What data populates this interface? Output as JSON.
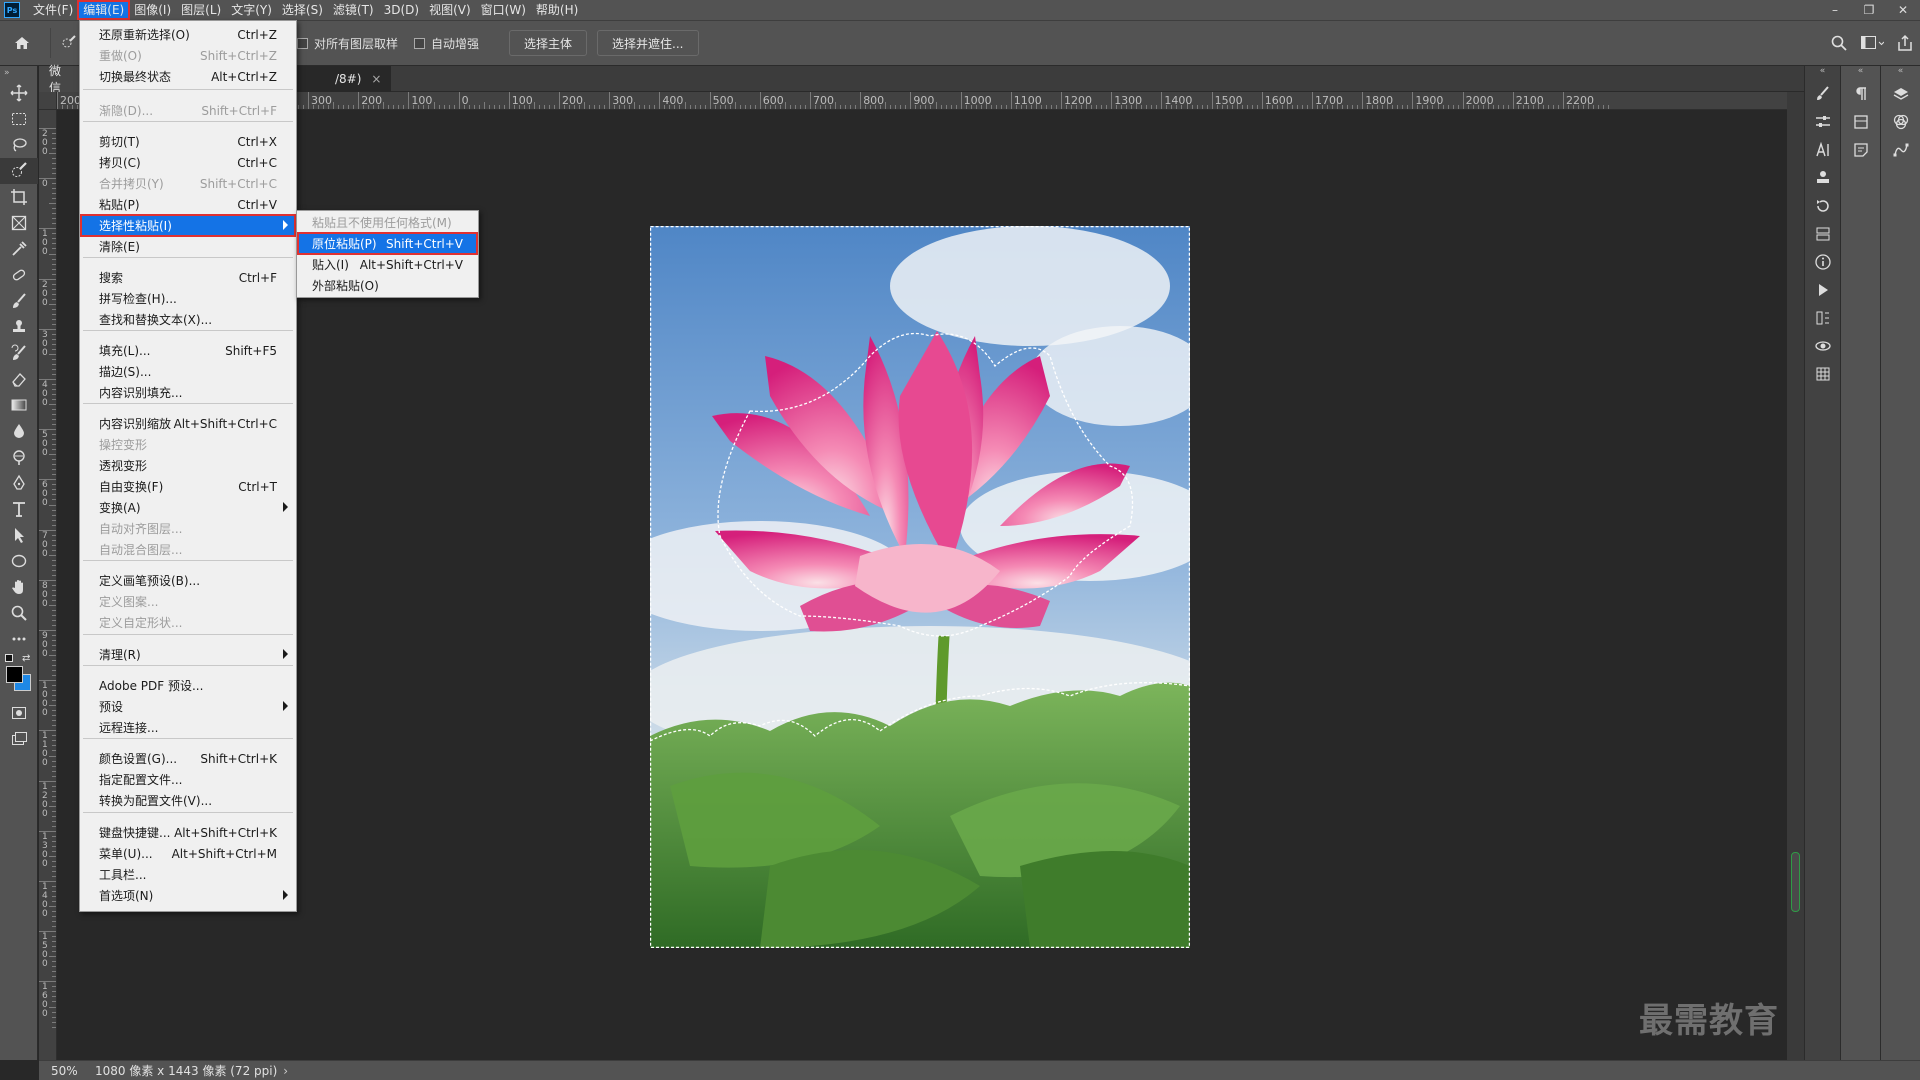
{
  "app": {
    "logo": "Ps"
  },
  "menubar": {
    "items": [
      "文件(F)",
      "编辑(E)",
      "图像(I)",
      "图层(L)",
      "文字(Y)",
      "选择(S)",
      "滤镜(T)",
      "3D(D)",
      "视图(V)",
      "窗口(W)",
      "帮助(H)"
    ],
    "active_index": 1
  },
  "window_controls": {
    "minimize": "–",
    "restore": "❐",
    "close": "✕"
  },
  "options": {
    "sample_all_layers": "对所有图层取样",
    "auto_enhance": "自动增强",
    "select_subject": "选择主体",
    "select_and_mask": "选择并遮住..."
  },
  "document": {
    "tab_partial_left": "微信",
    "tab_label": "/8#)",
    "tab_close": "×",
    "zoom": "50%",
    "dimensions": "1080 像素 x 1443 像素 (72 ppi)"
  },
  "ruler_h": [
    "200",
    "700",
    "600",
    "500",
    "400",
    "300",
    "200",
    "100",
    "0",
    "100",
    "200",
    "300",
    "400",
    "500",
    "600",
    "700",
    "800",
    "900",
    "1000",
    "1100",
    "1200",
    "1300",
    "1400",
    "1500",
    "1600",
    "1700",
    "1800",
    "1900",
    "2000",
    "2100",
    "2200"
  ],
  "ruler_v": [
    "200",
    "0",
    "100",
    "200",
    "300",
    "400",
    "500",
    "600",
    "700",
    "800",
    "900",
    "1000",
    "1100",
    "1200",
    "1300",
    "1400",
    "1500",
    "1600"
  ],
  "edit_menu": {
    "items": [
      {
        "label": "还原重新选择(O)",
        "shortcut": "Ctrl+Z",
        "disabled": false
      },
      {
        "label": "重做(O)",
        "shortcut": "Shift+Ctrl+Z",
        "disabled": true
      },
      {
        "label": "切换最终状态",
        "shortcut": "Alt+Ctrl+Z",
        "disabled": false
      },
      {
        "label": "渐隐(D)...",
        "shortcut": "Shift+Ctrl+F",
        "disabled": true
      },
      {
        "label": "剪切(T)",
        "shortcut": "Ctrl+X",
        "disabled": false
      },
      {
        "label": "拷贝(C)",
        "shortcut": "Ctrl+C",
        "disabled": false
      },
      {
        "label": "合并拷贝(Y)",
        "shortcut": "Shift+Ctrl+C",
        "disabled": true
      },
      {
        "label": "粘贴(P)",
        "shortcut": "Ctrl+V",
        "disabled": false
      },
      {
        "label": "选择性粘贴(I)",
        "shortcut": "",
        "disabled": false
      },
      {
        "label": "清除(E)",
        "shortcut": "",
        "disabled": false
      },
      {
        "label": "搜索",
        "shortcut": "Ctrl+F",
        "disabled": false
      },
      {
        "label": "拼写检查(H)...",
        "shortcut": "",
        "disabled": false
      },
      {
        "label": "查找和替换文本(X)...",
        "shortcut": "",
        "disabled": false
      },
      {
        "label": "填充(L)...",
        "shortcut": "Shift+F5",
        "disabled": false
      },
      {
        "label": "描边(S)...",
        "shortcut": "",
        "disabled": false
      },
      {
        "label": "内容识别填充...",
        "shortcut": "",
        "disabled": false
      },
      {
        "label": "内容识别缩放",
        "shortcut": "Alt+Shift+Ctrl+C",
        "disabled": false
      },
      {
        "label": "操控变形",
        "shortcut": "",
        "disabled": true
      },
      {
        "label": "透视变形",
        "shortcut": "",
        "disabled": false
      },
      {
        "label": "自由变换(F)",
        "shortcut": "Ctrl+T",
        "disabled": false
      },
      {
        "label": "变换(A)",
        "shortcut": "",
        "disabled": false
      },
      {
        "label": "自动对齐图层...",
        "shortcut": "",
        "disabled": true
      },
      {
        "label": "自动混合图层...",
        "shortcut": "",
        "disabled": true
      },
      {
        "label": "定义画笔预设(B)...",
        "shortcut": "",
        "disabled": false
      },
      {
        "label": "定义图案...",
        "shortcut": "",
        "disabled": true
      },
      {
        "label": "定义自定形状...",
        "shortcut": "",
        "disabled": true
      },
      {
        "label": "清理(R)",
        "shortcut": "",
        "disabled": false
      },
      {
        "label": "Adobe PDF 预设...",
        "shortcut": "",
        "disabled": false
      },
      {
        "label": "预设",
        "shortcut": "",
        "disabled": false
      },
      {
        "label": "远程连接...",
        "shortcut": "",
        "disabled": false
      },
      {
        "label": "颜色设置(G)...",
        "shortcut": "Shift+Ctrl+K",
        "disabled": false
      },
      {
        "label": "指定配置文件...",
        "shortcut": "",
        "disabled": false
      },
      {
        "label": "转换为配置文件(V)...",
        "shortcut": "",
        "disabled": false
      },
      {
        "label": "键盘快捷键...",
        "shortcut": "Alt+Shift+Ctrl+K",
        "disabled": false
      },
      {
        "label": "菜单(U)...",
        "shortcut": "Alt+Shift+Ctrl+M",
        "disabled": false
      },
      {
        "label": "工具栏...",
        "shortcut": "",
        "disabled": false
      },
      {
        "label": "首选项(N)",
        "shortcut": "",
        "disabled": false
      }
    ],
    "highlighted_index": 8,
    "submenu_indices": [
      8,
      20,
      26,
      28,
      36
    ]
  },
  "paste_submenu": {
    "items": [
      {
        "label": "粘贴且不使用任何格式(M)",
        "shortcut": "",
        "disabled": true
      },
      {
        "label": "原位粘贴(P)",
        "shortcut": "Shift+Ctrl+V",
        "disabled": false
      },
      {
        "label": "贴入(I)",
        "shortcut": "Alt+Shift+Ctrl+V",
        "disabled": false
      },
      {
        "label": "外部粘贴(O)",
        "shortcut": "",
        "disabled": false
      }
    ],
    "highlighted_index": 1
  },
  "watermark": "最需教育",
  "colors": {
    "highlight": "#1473e6",
    "annotation_red": "#e03131",
    "chrome": "#535353",
    "canvas": "#282828"
  }
}
